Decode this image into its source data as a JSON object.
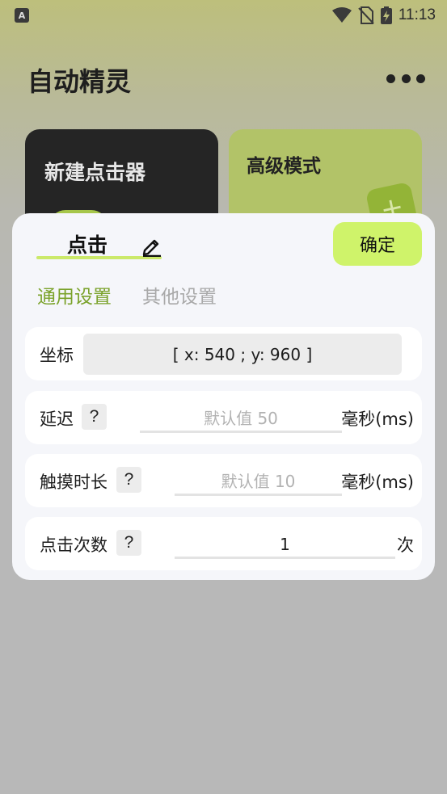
{
  "status_bar": {
    "app_icon_letter": "A",
    "time": "11:13",
    "icons": [
      "wifi-icon",
      "no-sim-icon",
      "battery-charging-icon"
    ]
  },
  "background_app": {
    "title": "自动精灵",
    "menu_icon": "more-dots-icon",
    "cards": [
      {
        "label": "新建点击器"
      },
      {
        "label": "高级模式",
        "icon": "plus-icon",
        "icon_glyph": "+"
      }
    ]
  },
  "dialog": {
    "name": "点击",
    "edit_icon": "pencil-icon",
    "confirm_label": "确定",
    "tabs": [
      {
        "label": "通用设置",
        "active": true
      },
      {
        "label": "其他设置",
        "active": false
      }
    ],
    "fields": {
      "coord": {
        "label": "坐标",
        "value": "[ x: 540 ; y: 960 ]"
      },
      "delay": {
        "label": "延迟",
        "help": "?",
        "placeholder": "默认值 50",
        "value": "",
        "unit": "毫秒(ms)"
      },
      "touch_duration": {
        "label": "触摸时长",
        "help": "?",
        "placeholder": "默认值 10",
        "value": "",
        "unit": "毫秒(ms)"
      },
      "click_count": {
        "label": "点击次数",
        "help": "?",
        "placeholder": "",
        "value": "1",
        "unit": "次"
      }
    }
  },
  "colors": {
    "accent_green": "#cff36a",
    "tab_active": "#7aa22a",
    "dialog_bg": "#f5f6fa",
    "scrim": "#b8b8b8"
  }
}
